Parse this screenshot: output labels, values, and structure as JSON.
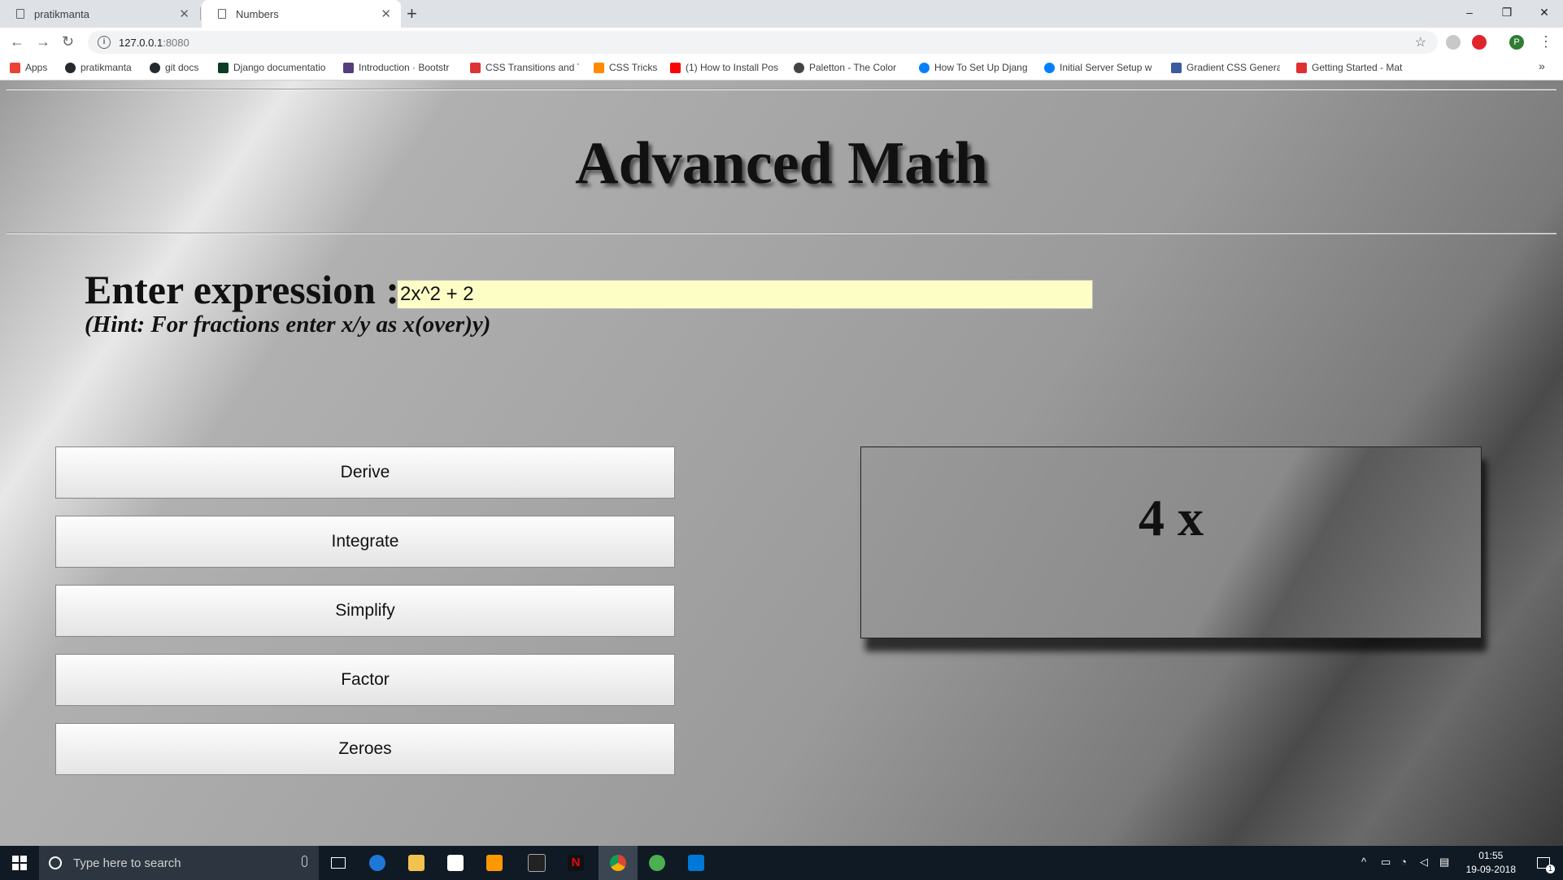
{
  "browser": {
    "tabs": [
      {
        "title": "pratikmanta",
        "active": false
      },
      {
        "title": "Numbers",
        "active": true
      }
    ],
    "new_tab": "+",
    "window_controls": {
      "minimize": "–",
      "restore": "❐",
      "close": "✕"
    },
    "url": "127.0.0.1",
    "url_port": ":8080",
    "bookmarks": [
      {
        "label": "Apps",
        "color": "#e94235"
      },
      {
        "label": "pratikmanta",
        "color": "#24292e"
      },
      {
        "label": "git docs",
        "color": "#24292e"
      },
      {
        "label": "Django documentatio",
        "color": "#0c3c26"
      },
      {
        "label": "Introduction · Bootstr",
        "color": "#563d7c"
      },
      {
        "label": "CSS Transitions and T",
        "color": "#d33"
      },
      {
        "label": "CSS Tricks",
        "color": "#ff8a00"
      },
      {
        "label": "(1) How to Install Pos",
        "color": "#ff0000"
      },
      {
        "label": "Paletton - The Color",
        "color": "#444"
      },
      {
        "label": "How To Set Up Djang",
        "color": "#0080ff"
      },
      {
        "label": "Initial Server Setup w",
        "color": "#0080ff"
      },
      {
        "label": "Gradient CSS Genera",
        "color": "#3a5ba0"
      },
      {
        "label": "Getting Started - Mat",
        "color": "#e03030"
      }
    ],
    "bookmarks_more": "»"
  },
  "page": {
    "title": "Advanced Math",
    "expression_label": "Enter expression :",
    "expression_value": "2x^2 + 2",
    "hint": "(Hint: For fractions enter x/y as x(over)y)",
    "buttons": {
      "derive": "Derive",
      "integrate": "Integrate",
      "simplify": "Simplify",
      "factor": "Factor",
      "zeroes": "Zeroes"
    },
    "result": "4 x"
  },
  "taskbar": {
    "search_placeholder": "Type here to search",
    "time": "01:55",
    "date": "19-09-2018",
    "notification_count": "1"
  }
}
